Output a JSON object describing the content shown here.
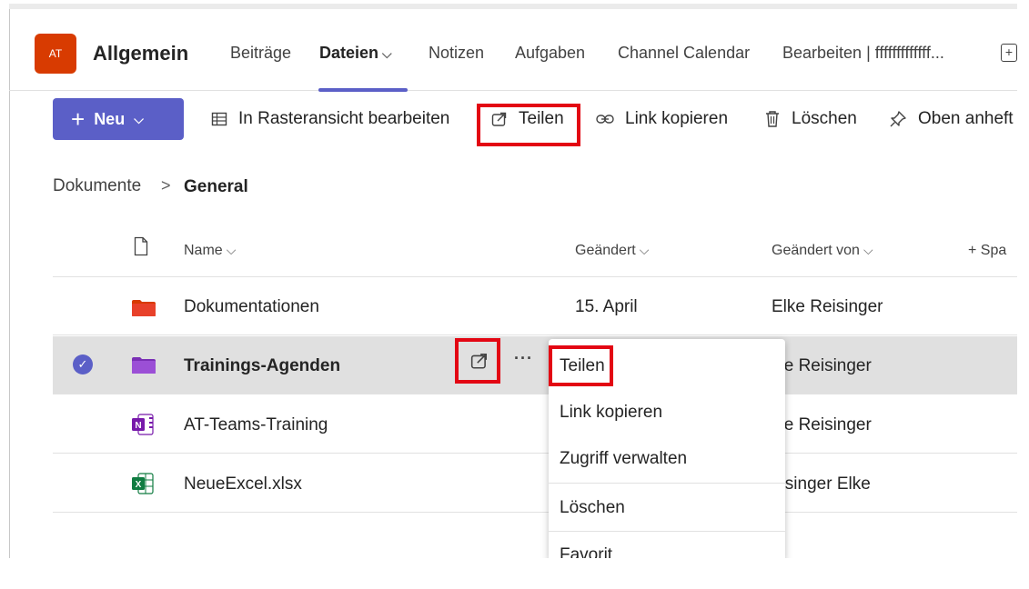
{
  "channel": {
    "avatar_text": "AT",
    "avatar_color": "#d83b01",
    "name": "Allgemein"
  },
  "tabs": [
    {
      "label": "Beiträge"
    },
    {
      "label": "Dateien",
      "active": true
    },
    {
      "label": "Notizen"
    },
    {
      "label": "Aufgaben"
    },
    {
      "label": "Channel Calendar"
    },
    {
      "label": "Bearbeiten | fffffffffffff..."
    }
  ],
  "toolbar": {
    "new_label": "Neu",
    "grid_edit_label": "In Rasteransicht bearbeiten",
    "share_label": "Teilen",
    "copy_link_label": "Link kopieren",
    "delete_label": "Löschen",
    "pin_label": "Oben anheft"
  },
  "breadcrumb": {
    "root": "Dokumente",
    "separator": ">",
    "current": "General"
  },
  "columns": {
    "name": "Name",
    "modified": "Geändert",
    "modified_by": "Geändert von",
    "add_column": "+ Spa"
  },
  "files": [
    {
      "name": "Dokumentationen",
      "type": "folder",
      "color": "#d83b01",
      "modified": "15. April",
      "modified_by": "Elke Reisinger"
    },
    {
      "name": "Trainings-Agenden",
      "type": "folder",
      "color": "#8a3fc4",
      "modified": "",
      "modified_by": "lke Reisinger",
      "selected": true
    },
    {
      "name": "AT-Teams-Training",
      "type": "onenote",
      "color": "#7719aa",
      "modified": "",
      "modified_by": "lke Reisinger"
    },
    {
      "name": "NeueExcel.xlsx",
      "type": "excel",
      "color": "#107c41",
      "modified": "",
      "modified_by": "eisinger Elke"
    }
  ],
  "context_menu": {
    "items": [
      "Teilen",
      "Link kopieren",
      "Zugriff verwalten",
      "Löschen",
      "Favorit"
    ]
  },
  "colors": {
    "accent": "#5b5fc7",
    "highlight": "#e30613"
  }
}
